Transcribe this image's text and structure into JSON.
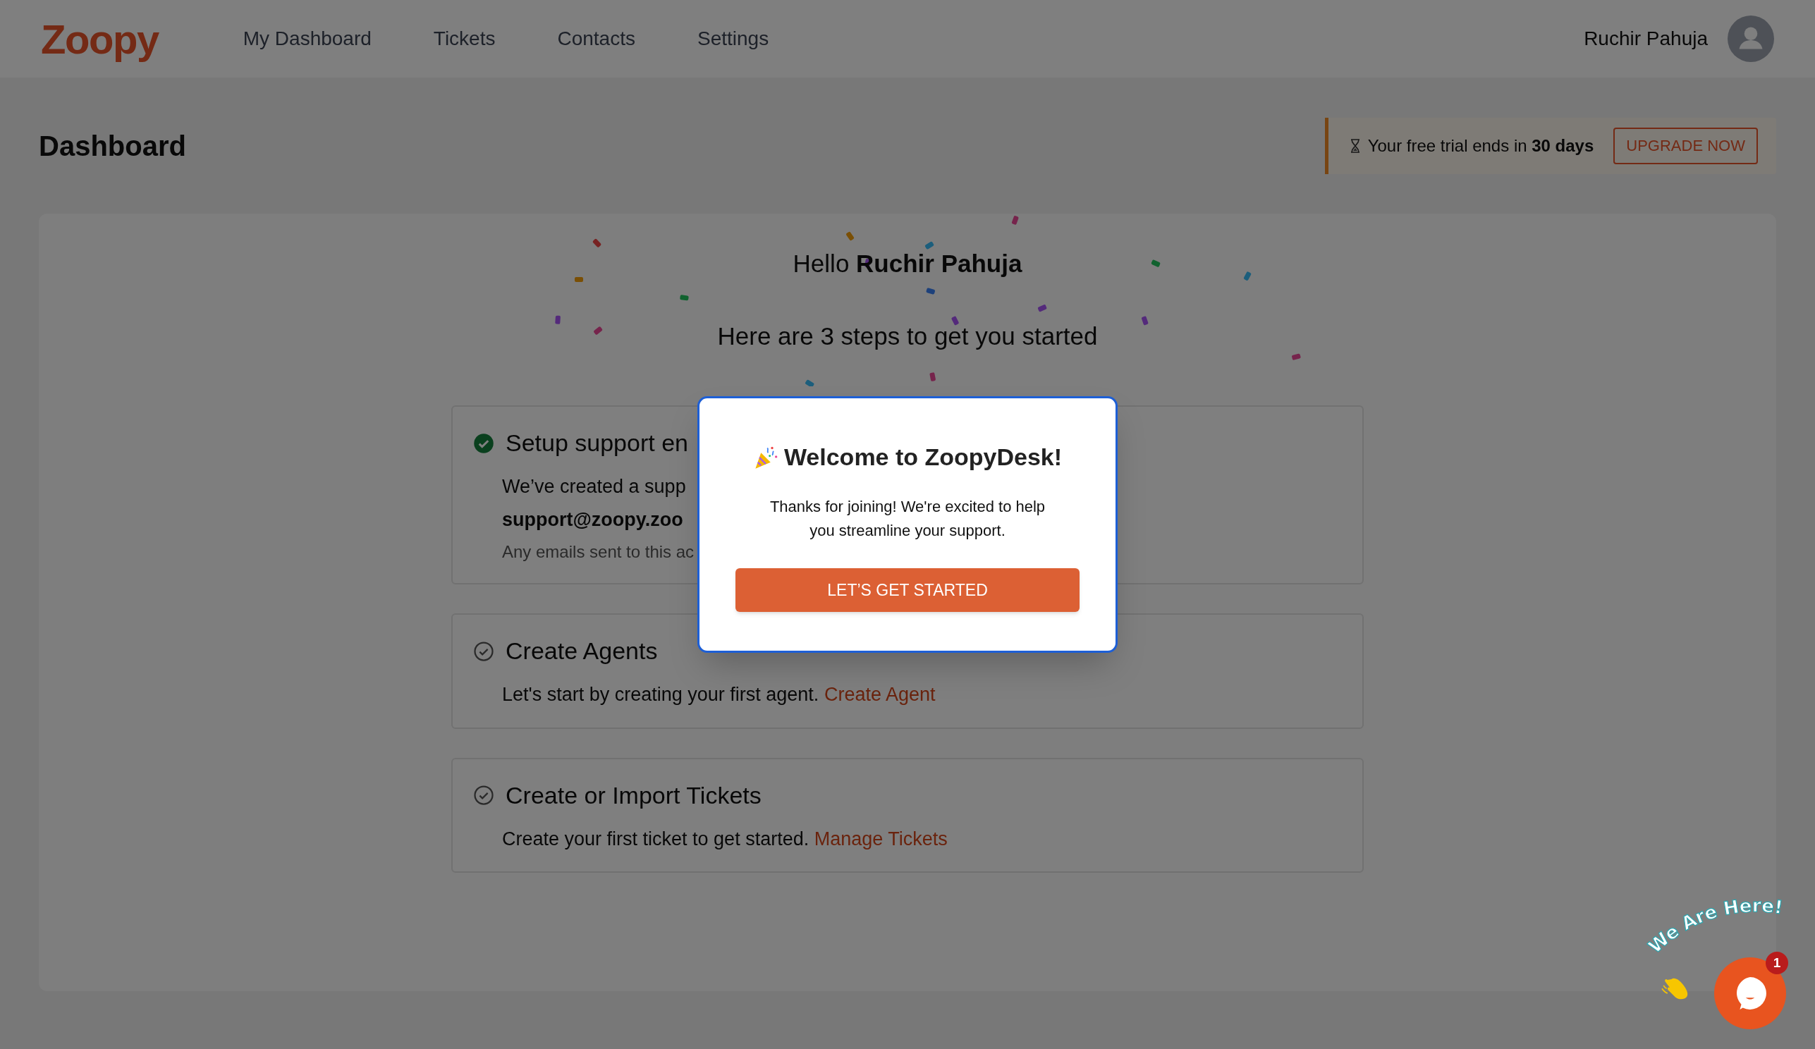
{
  "header": {
    "logo": "Zoopy",
    "nav": [
      {
        "label": "My Dashboard"
      },
      {
        "label": "Tickets"
      },
      {
        "label": "Contacts"
      },
      {
        "label": "Settings"
      }
    ],
    "user_name": "Ruchir Pahuja"
  },
  "page_title": "Dashboard",
  "trial_banner": {
    "text": "Your free trial ends in **30 days**",
    "button": "UPGRADE NOW"
  },
  "greeting": "Hello **Ruchir Pahuja**",
  "subtitle": "Here are 3 steps to get you started",
  "steps": [
    {
      "title": "Setup support en",
      "completed": true,
      "description": "We’ve created a supp",
      "email": "support@zoopy.zoo",
      "note": "Any emails sent to this ac"
    },
    {
      "title": "Create Agents",
      "completed": false,
      "description": "Let's start by creating your first agent.",
      "link": "Create Agent"
    },
    {
      "title": "Create or Import Tickets",
      "completed": false,
      "description": "Create your first ticket to get started.",
      "link": "Manage Tickets"
    }
  ],
  "modal": {
    "title": "Welcome to ZoopyDesk!",
    "message": "Thanks for joining! We're excited to help you streamline your support.",
    "button": "LET’S GET STARTED"
  },
  "chat_widget": {
    "caption": "We Are Here!",
    "badge": "1"
  }
}
